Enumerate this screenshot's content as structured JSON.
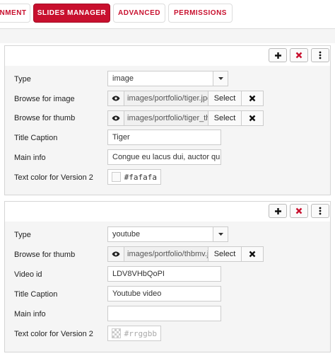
{
  "tabs": [
    {
      "label": "NMENT",
      "active": false
    },
    {
      "label": "SLIDES MANAGER",
      "active": true
    },
    {
      "label": "ADVANCED",
      "active": false
    },
    {
      "label": "PERMISSIONS",
      "active": false
    }
  ],
  "slides": [
    {
      "type_label": "Type",
      "type_value": "image",
      "browse_image_label": "Browse for image",
      "browse_image_path": "images/portfolio/tiger.jpg",
      "browse_thumb_label": "Browse for thumb",
      "browse_thumb_path": "images/portfolio/tiger_th",
      "select_label": "Select",
      "title_caption_label": "Title Caption",
      "title_caption_value": "Tiger",
      "main_info_label": "Main info",
      "main_info_value": "Congue eu lacus dui, auctor quis ul",
      "text_color_label": "Text color for Version 2",
      "text_color_value": "#fafafa",
      "text_color_swatch": "#fafafa"
    },
    {
      "type_label": "Type",
      "type_value": "youtube",
      "browse_thumb_label": "Browse for thumb",
      "browse_thumb_path": "images/portfolio/thbmv.j",
      "select_label": "Select",
      "video_id_label": "Video id",
      "video_id_value": "LDV8VHbQoPI",
      "title_caption_label": "Title Caption",
      "title_caption_value": "Youtube video",
      "main_info_label": "Main info",
      "main_info_value": "",
      "text_color_label": "Text color for Version 2",
      "text_color_placeholder": "#rrggbb"
    }
  ],
  "colors": {
    "accent": "#c8102e",
    "panel_bg": "#f5f5f5"
  },
  "icons": [
    "plus-icon",
    "times-icon",
    "more-vertical-icon",
    "eye-icon",
    "caret-down-icon"
  ]
}
